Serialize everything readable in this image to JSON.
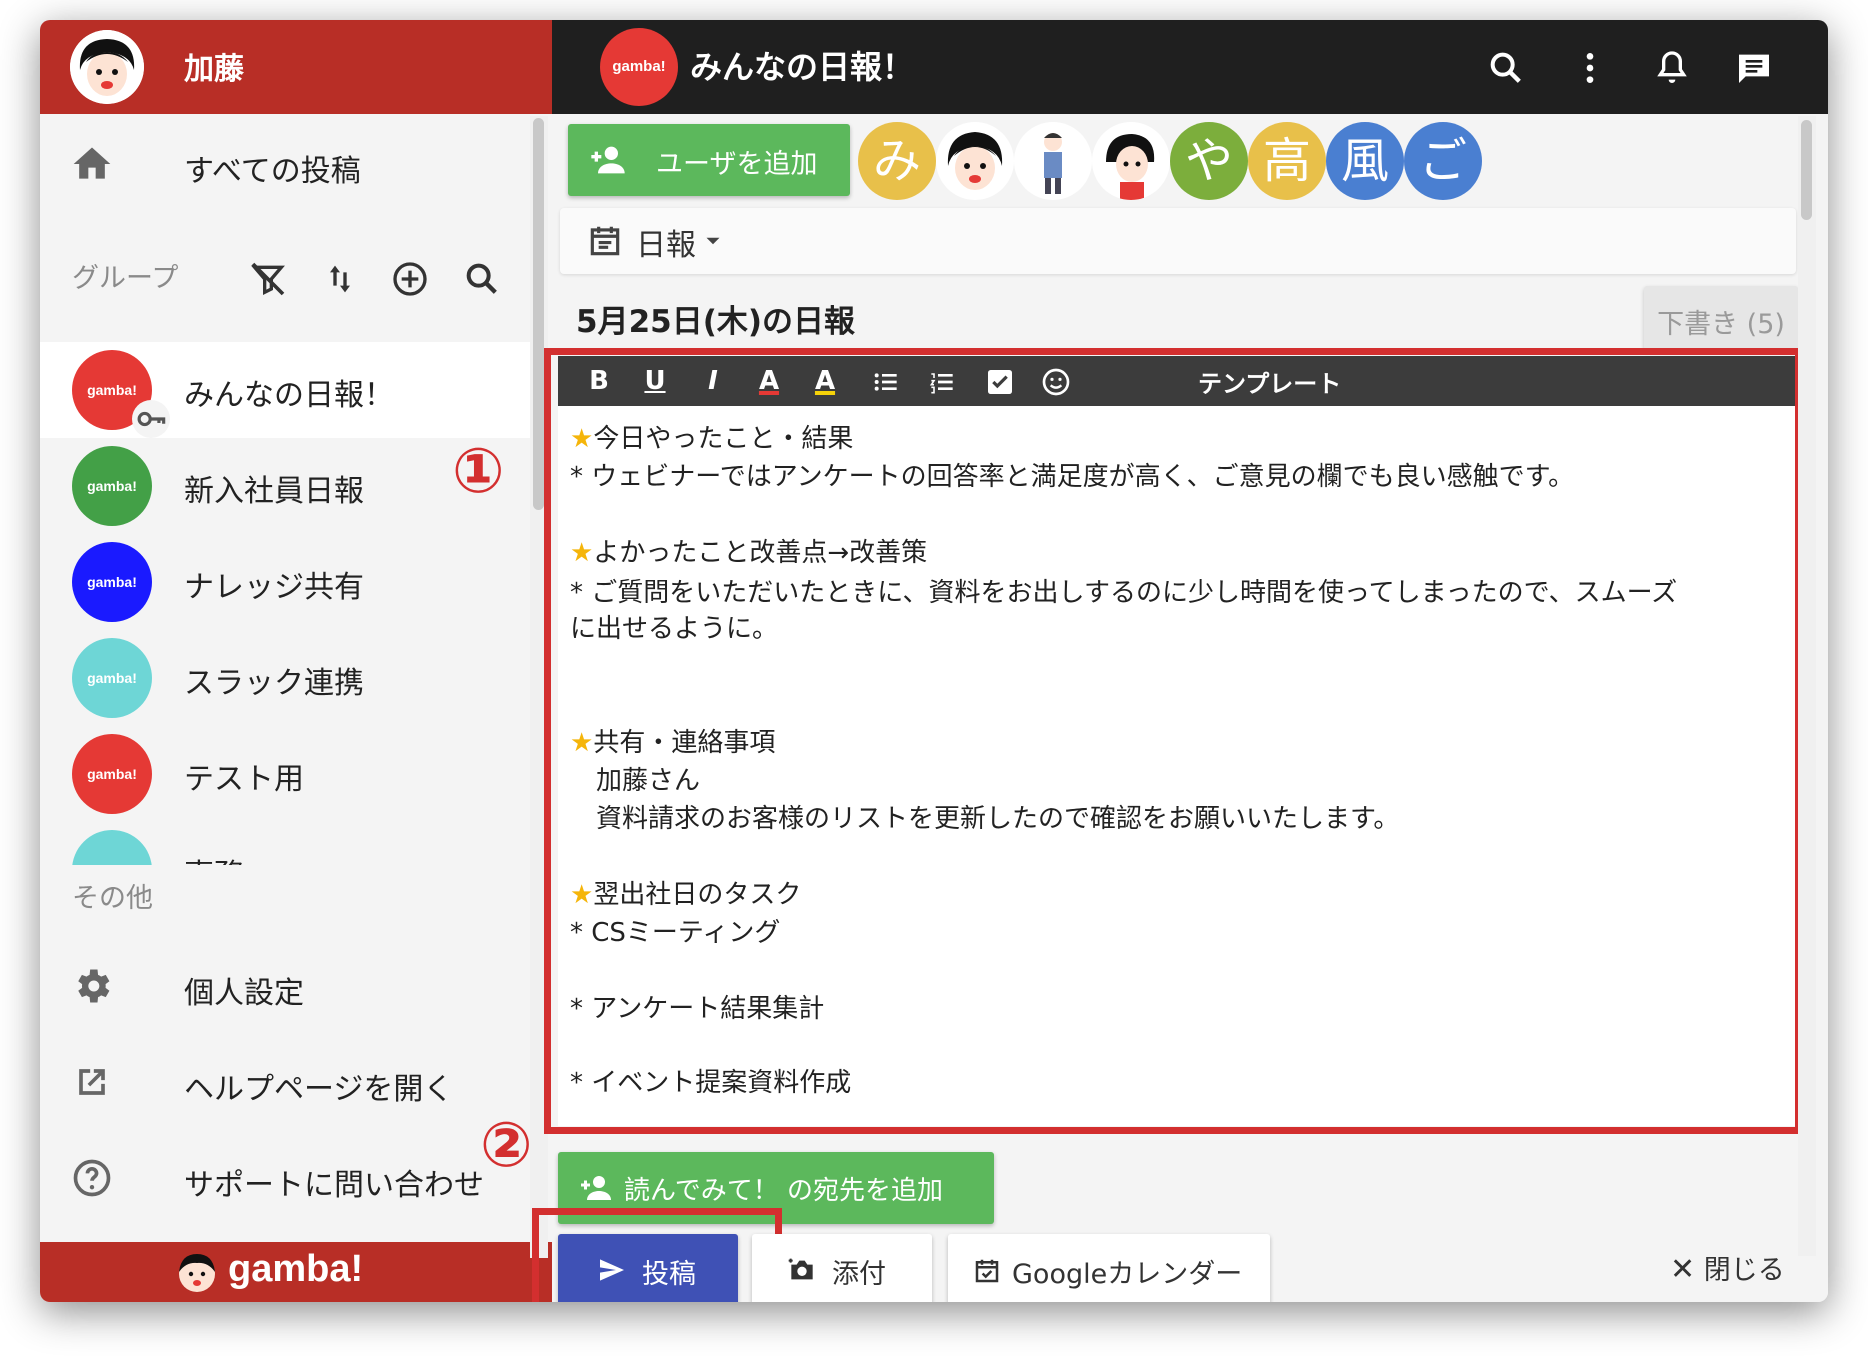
{
  "sidebar": {
    "username": "加藤",
    "nav_all_posts": "すべての投稿",
    "groups_label": "グループ",
    "groups": [
      {
        "name": "みんなの日報！",
        "avatar_text": "gamba!",
        "color": "#e53935"
      },
      {
        "name": "新入社員日報",
        "avatar_text": "gamba!",
        "color": "#43a047"
      },
      {
        "name": "ナレッジ共有",
        "avatar_text": "gamba!",
        "color": "#1a1aff"
      },
      {
        "name": "スラック連携",
        "avatar_text": "gamba!",
        "color": "#6ed6d6"
      },
      {
        "name": "テスト用",
        "avatar_text": "gamba!",
        "color": "#e53935"
      },
      {
        "name": "事務",
        "avatar_text": "",
        "color": "#6ed6d6"
      }
    ],
    "other_label": "その他",
    "settings_label": "個人設定",
    "help_label": "ヘルプページを開く",
    "support_label": "サポートに問い合わせ",
    "footer_brand": "gamba!"
  },
  "annotations": {
    "marker_1": "①",
    "marker_2": "②"
  },
  "topbar": {
    "logo_text": "gamba!",
    "title": "みんなの日報！"
  },
  "members": {
    "add_user_label": "ユーザを追加",
    "avatars": [
      {
        "text": "み",
        "color": "#e8c04a"
      },
      {
        "text": "",
        "color": "#ffffff"
      },
      {
        "text": "",
        "color": "#ffffff"
      },
      {
        "text": "",
        "color": "#ffffff"
      },
      {
        "text": "や",
        "color": "#7cae3c"
      },
      {
        "text": "高",
        "color": "#e8c04a"
      },
      {
        "text": "風",
        "color": "#4a7fd1"
      },
      {
        "text": "ご",
        "color": "#4a7fd1"
      }
    ]
  },
  "post": {
    "type_label": "日報",
    "title": "5月25日(木)の日報",
    "draft_label": "下書き (5)",
    "toolbar": {
      "bold": "B",
      "underline": "U",
      "italic": "I",
      "text_color": "A",
      "highlight": "A",
      "template_label": "テンプレート"
    },
    "body": {
      "l1_star": "★",
      "l1": "今日やったこと・結果",
      "l2": "* ウェビナーではアンケートの回答率と満足度が高く、ご意見の欄でも良い感触です。",
      "l3_star": "★",
      "l3": "よかったこと改善点→改善策",
      "l4": "* ご質問をいただいたときに、資料をお出しするのに少し時間を使ってしまったので、スムーズ",
      "l5": "に出せるように。",
      "l6_star": "★",
      "l6": "共有・連絡事項",
      "l7": "加藤さん",
      "l8": "資料請求のお客様のリストを更新したので確認をお願いいたします。",
      "l9_star": "★",
      "l9": "翌出社日のタスク",
      "l10": "* CSミーティング",
      "l11": "* アンケート結果集計",
      "l12": "* イベント提案資料作成"
    },
    "read_request_label": "読んでみて！ の宛先を追加",
    "submit_label": "投稿",
    "attach_label": "添付",
    "calendar_label": "Googleカレンダー",
    "close_label": "閉じる"
  },
  "colors": {
    "brand_red": "#b82e26",
    "topbar": "#1f1f1f",
    "green_button": "#5cb85c",
    "submit_blue": "#3f51b5",
    "annotation_red": "#d32f2f",
    "star": "#f5b50a"
  }
}
